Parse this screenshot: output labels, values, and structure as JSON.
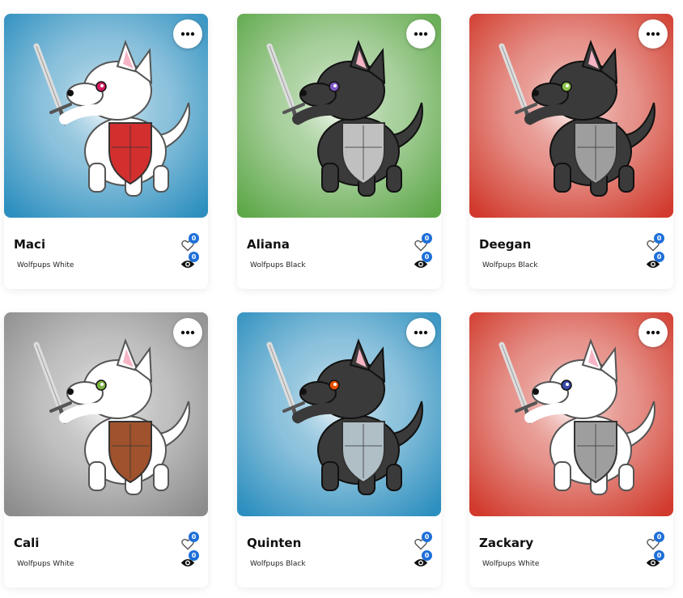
{
  "cards": [
    {
      "name": "Maci",
      "collection": "Wolfpups White",
      "likes": "0",
      "views": "0",
      "bg": "#2d8fbf",
      "fur": "#ffffff",
      "eye": "#d81b60",
      "shield": "#d32f2f"
    },
    {
      "name": "Aliana",
      "collection": "Wolfpups Black",
      "likes": "0",
      "views": "0",
      "bg": "#5fa84a",
      "fur": "#3a3a3a",
      "eye": "#7e57c2",
      "shield": "#c0c0c0"
    },
    {
      "name": "Deegan",
      "collection": "Wolfpups Black",
      "likes": "0",
      "views": "0",
      "bg": "#d13a2c",
      "fur": "#3a3a3a",
      "eye": "#8bc34a",
      "shield": "#9e9e9e"
    },
    {
      "name": "Cali",
      "collection": "Wolfpups White",
      "likes": "0",
      "views": "0",
      "bg": "#8c8c8c",
      "fur": "#ffffff",
      "eye": "#7cb342",
      "shield": "#a0522d"
    },
    {
      "name": "Quinten",
      "collection": "Wolfpups Black",
      "likes": "0",
      "views": "0",
      "bg": "#2d8fbf",
      "fur": "#3a3a3a",
      "eye": "#e65100",
      "shield": "#b0bec5"
    },
    {
      "name": "Zackary",
      "collection": "Wolfpups White",
      "likes": "0",
      "views": "0",
      "bg": "#d13a2c",
      "fur": "#ffffff",
      "eye": "#3949ab",
      "shield": "#9e9e9e"
    }
  ]
}
